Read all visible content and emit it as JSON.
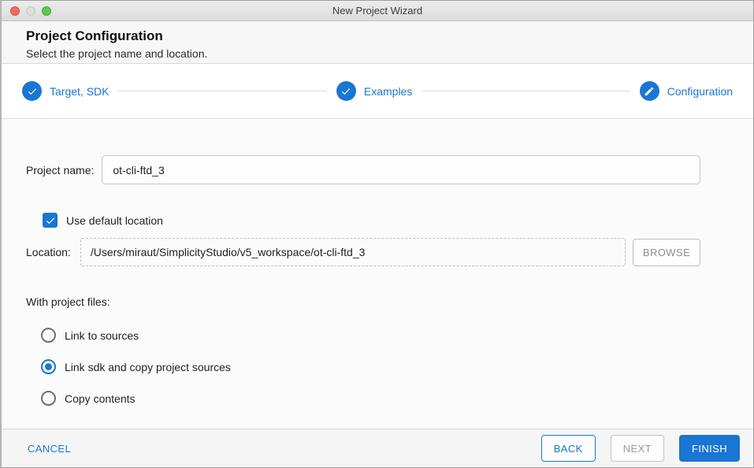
{
  "window": {
    "title": "New Project Wizard"
  },
  "header": {
    "title": "Project Configuration",
    "subtitle": "Select the project name and location."
  },
  "stepper": {
    "steps": [
      {
        "label": "Target, SDK",
        "icon": "check-icon",
        "state": "complete"
      },
      {
        "label": "Examples",
        "icon": "check-icon",
        "state": "complete"
      },
      {
        "label": "Configuration",
        "icon": "pencil-icon",
        "state": "current"
      }
    ]
  },
  "form": {
    "project_name": {
      "label": "Project name:",
      "value": "ot-cli-ftd_3"
    },
    "use_default_location": {
      "label": "Use default location",
      "checked": true
    },
    "location": {
      "label": "Location:",
      "value": "/Users/miraut/SimplicityStudio/v5_workspace/ot-cli-ftd_3",
      "browse_label": "BROWSE"
    },
    "with_project_files": {
      "label": "With project files:",
      "options": [
        {
          "label": "Link to sources",
          "selected": false
        },
        {
          "label": "Link sdk and copy project sources",
          "selected": true
        },
        {
          "label": "Copy contents",
          "selected": false
        }
      ]
    }
  },
  "footer": {
    "cancel_label": "CANCEL",
    "back_label": "BACK",
    "next_label": "NEXT",
    "finish_label": "FINISH"
  },
  "colors": {
    "accent": "#1976d2",
    "titlebar_close": "#ee6a5e",
    "titlebar_zoom": "#61c454"
  }
}
